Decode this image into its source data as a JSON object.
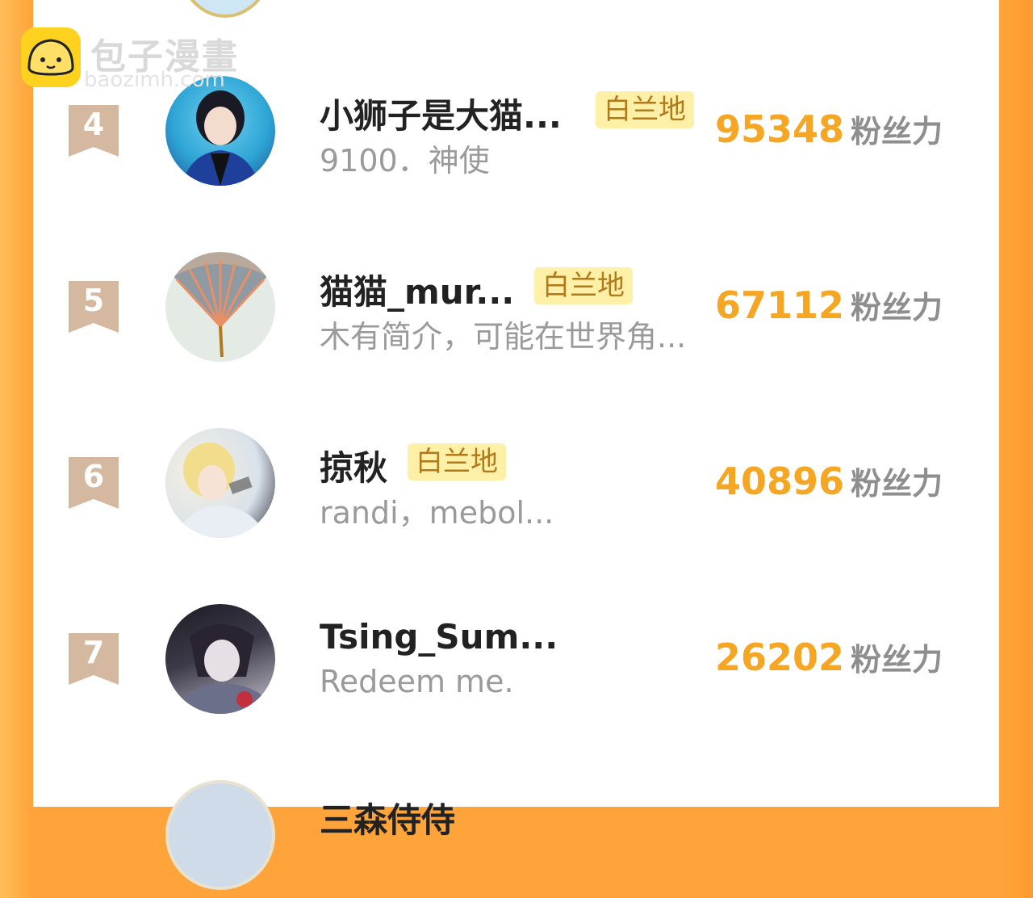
{
  "watermark": {
    "brand": "包子漫畫",
    "domain": "baozimh.com"
  },
  "fans_label": "粉丝力",
  "rows": [
    {
      "rank": "4",
      "name": "小狮子是大猫...",
      "tag": "白兰地",
      "bio": "9100．神使",
      "fans": "95348"
    },
    {
      "rank": "5",
      "name": "猫猫_mur...",
      "tag": "白兰地",
      "bio": "木有简介，可能在世界角...",
      "fans": "67112"
    },
    {
      "rank": "6",
      "name": "掠秋",
      "tag": "白兰地",
      "bio": "randi，mebol...",
      "fans": "40896"
    },
    {
      "rank": "7",
      "name": "Tsing_Sum...",
      "tag": "",
      "bio": "Redeem me.",
      "fans": "26202"
    },
    {
      "rank": "",
      "name": "三森侍侍",
      "tag": "",
      "bio": "",
      "fans": ""
    }
  ],
  "colors": {
    "accent": "#f5a623",
    "tag_bg": "#fff0a8",
    "rank_badge": "#d4b8a0"
  }
}
